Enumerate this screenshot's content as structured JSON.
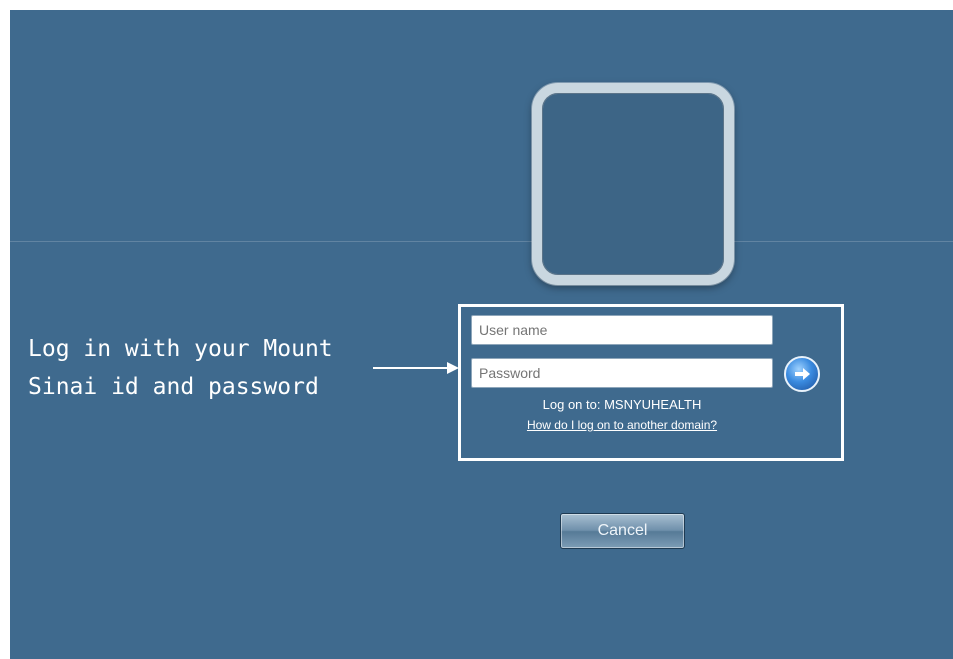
{
  "annotation": {
    "text": "Log in with your Mount\nSinai id and password"
  },
  "login": {
    "username_placeholder": "User name",
    "password_placeholder": "Password",
    "logon_to": "Log on to: MSNYUHEALTH",
    "other_domain_link": "How do I log on to another domain?",
    "go_icon": "arrow-right-icon"
  },
  "cancel_label": "Cancel"
}
